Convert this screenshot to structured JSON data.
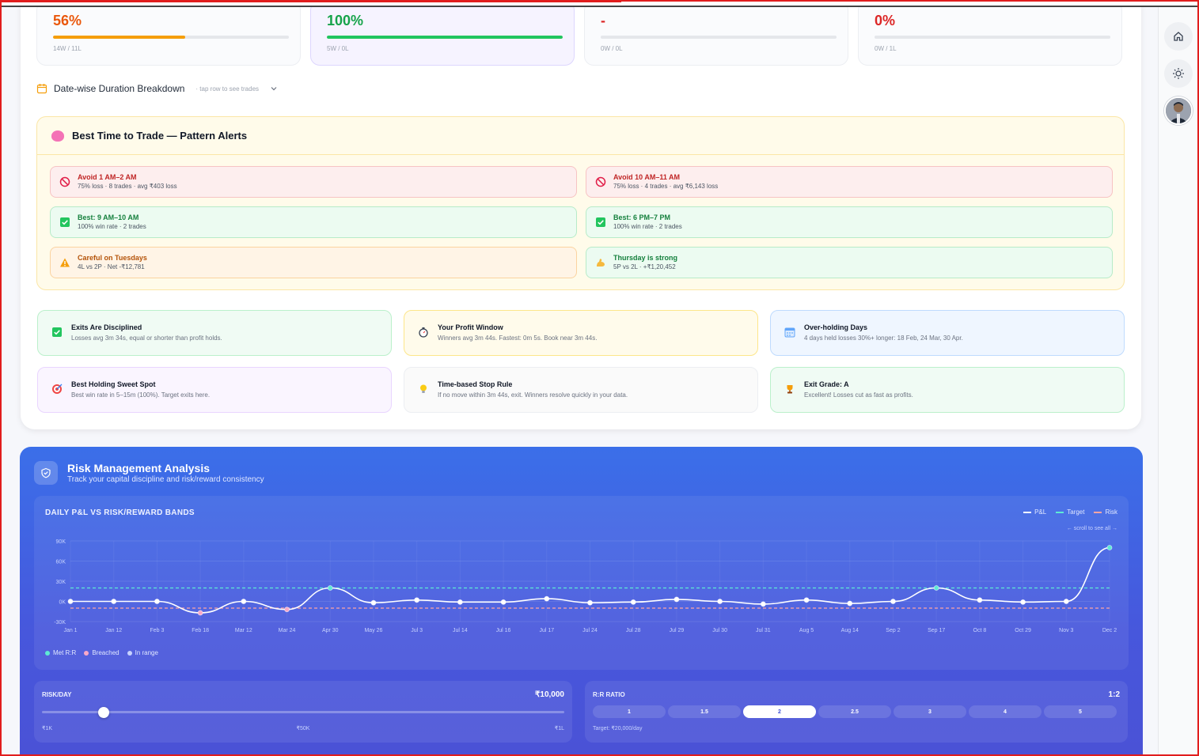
{
  "stats": [
    {
      "value": "56%",
      "color": "#ea580c",
      "bar_color": "#f59e0b",
      "progress": 56,
      "record": "14W / 11L",
      "active": false
    },
    {
      "value": "100%",
      "color": "#16a34a",
      "bar_color": "#22c55e",
      "progress": 100,
      "record": "5W / 0L",
      "active": true
    },
    {
      "value": "-",
      "color": "#dc2626",
      "bar_color": "#e5e7eb",
      "progress": 0,
      "record": "0W / 0L",
      "active": false
    },
    {
      "value": "0%",
      "color": "#dc2626",
      "bar_color": "#e5e7eb",
      "progress": 0,
      "record": "0W / 1L",
      "active": false
    }
  ],
  "duration_section": {
    "title": "Date-wise Duration Breakdown",
    "hint": "· tap row to see trades"
  },
  "alerts": {
    "title": "Best Time to Trade — Pattern Alerts",
    "items": [
      {
        "kind": "red",
        "icon": "ban-icon",
        "title": "Avoid 1 AM–2 AM",
        "detail": "75% loss · 8 trades · avg ₹403 loss"
      },
      {
        "kind": "red",
        "icon": "ban-icon",
        "title": "Avoid 10 AM–11 AM",
        "detail": "75% loss · 4 trades · avg ₹6,143 loss"
      },
      {
        "kind": "green",
        "icon": "check-box-icon",
        "title": "Best: 9 AM–10 AM",
        "detail": "100% win rate · 2 trades"
      },
      {
        "kind": "green",
        "icon": "check-box-icon",
        "title": "Best: 6 PM–7 PM",
        "detail": "100% win rate · 2 trades"
      },
      {
        "kind": "orange",
        "icon": "warning-icon",
        "title": "Careful on Tuesdays",
        "detail": "4L vs 2P · Net -₹12,781"
      },
      {
        "kind": "green",
        "icon": "flexed-arm-icon",
        "title": "Thursday is strong",
        "detail": "5P vs 2L · +₹1,20,452"
      }
    ]
  },
  "insights": [
    {
      "kind": "green",
      "icon": "check-box-icon",
      "title": "Exits Are Disciplined",
      "detail": "Losses avg 3m 34s, equal or shorter than profit holds."
    },
    {
      "kind": "yellow",
      "icon": "stopwatch-icon",
      "title": "Your Profit Window",
      "detail": "Winners avg 3m 44s. Fastest: 0m 5s. Book near 3m 44s."
    },
    {
      "kind": "blue",
      "icon": "calendar-icon",
      "title": "Over-holding Days",
      "detail": "4 days held losses 30%+ longer: 18 Feb, 24 Mar, 30 Apr."
    },
    {
      "kind": "purple",
      "icon": "target-icon",
      "title": "Best Holding Sweet Spot",
      "detail": "Best win rate in 5–15m (100%). Target exits here."
    },
    {
      "kind": "grey",
      "icon": "lightbulb-icon",
      "title": "Time-based Stop Rule",
      "detail": "If no move within 3m 44s, exit. Winners resolve quickly in your data."
    },
    {
      "kind": "green",
      "icon": "trophy-icon",
      "title": "Exit Grade: A",
      "detail": "Excellent! Losses cut as fast as profits."
    }
  ],
  "risk": {
    "title": "Risk Management Analysis",
    "subtitle": "Track your capital discipline and risk/reward consistency",
    "legend": [
      "P&L",
      "Target",
      "Risk"
    ],
    "legend_colors": [
      "#ffffff",
      "#5eead4",
      "#fca5a5"
    ],
    "scroll_hint": "← scroll to see all →",
    "status_legend": [
      "Met R:R",
      "Breached",
      "In range"
    ],
    "status_colors": [
      "#5eead4",
      "#f9a8c8",
      "#c7d2fe"
    ],
    "risk_day": {
      "label": "RISK/DAY",
      "value": "₹10,000",
      "ticks": [
        "₹1K",
        "₹50K",
        "₹1L"
      ],
      "fraction": 0.05
    },
    "rr": {
      "label": "R:R RATIO",
      "value": "1:2",
      "options": [
        "1",
        "1.5",
        "2",
        "2.5",
        "3",
        "4",
        "5"
      ],
      "selected": 2,
      "target": "Target: ₹20,000/day"
    }
  },
  "chart_data": {
    "type": "line",
    "title": "DAILY P&L VS RISK/REWARD BANDS",
    "y_ticks": [
      "90K",
      "60K",
      "30K",
      "0K",
      "-30K"
    ],
    "ylim": [
      -30000,
      90000
    ],
    "target": 20000,
    "risk": -10000,
    "categories": [
      "Jan 1",
      "Jan 12",
      "Feb 3",
      "Feb 18",
      "Mar 12",
      "Mar 24",
      "Apr 30",
      "May 26",
      "Jul 3",
      "Jul 14",
      "Jul 16",
      "Jul 17",
      "Jul 24",
      "Jul 28",
      "Jul 29",
      "Jul 30",
      "Jul 31",
      "Aug 5",
      "Aug 14",
      "Sep 2",
      "Sep 17",
      "Oct 8",
      "Oct 29",
      "Nov 3",
      "Dec 2"
    ],
    "series": [
      {
        "values": [
          0,
          0,
          0,
          -17000,
          0,
          -12000,
          20000,
          -2000,
          2000,
          -1000,
          -1000,
          4000,
          -2000,
          -1000,
          3000,
          0,
          -4000,
          2000,
          -3000,
          0,
          20000,
          2000,
          -1000,
          0,
          80000
        ]
      }
    ],
    "status": [
      "range",
      "range",
      "range",
      "breach",
      "range",
      "breach",
      "met",
      "range",
      "range",
      "range",
      "range",
      "range",
      "range",
      "range",
      "range",
      "range",
      "range",
      "range",
      "range",
      "range",
      "met",
      "range",
      "range",
      "range",
      "met"
    ]
  }
}
